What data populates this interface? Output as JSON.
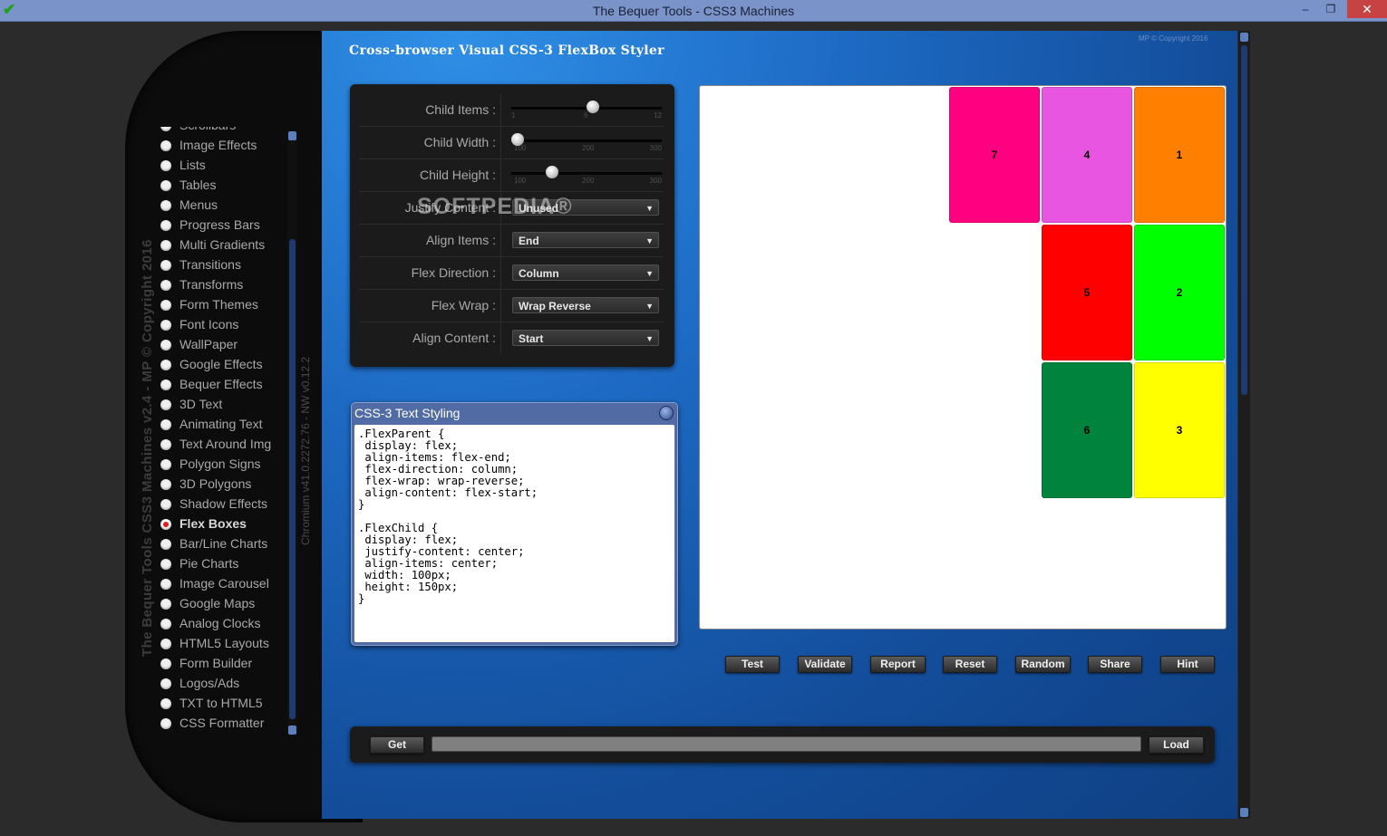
{
  "window": {
    "title": "The Bequer Tools - CSS3 Machines",
    "minimize_glyph": "–",
    "maximize_glyph": "❐",
    "close_glyph": "✕"
  },
  "sidebar": {
    "vertical_title": "The Bequer Tools CSS3 Machines v2.4 - MP © Copyright 2016",
    "vertical_version": "Chromium v41.0.2272.76 - NW v0.12.2",
    "items": [
      {
        "label": "Scrollbars",
        "selected": false
      },
      {
        "label": "Image Effects",
        "selected": false
      },
      {
        "label": "Lists",
        "selected": false
      },
      {
        "label": "Tables",
        "selected": false
      },
      {
        "label": "Menus",
        "selected": false
      },
      {
        "label": "Progress Bars",
        "selected": false
      },
      {
        "label": "Multi Gradients",
        "selected": false
      },
      {
        "label": "Transitions",
        "selected": false
      },
      {
        "label": "Transforms",
        "selected": false
      },
      {
        "label": "Form Themes",
        "selected": false
      },
      {
        "label": "Font Icons",
        "selected": false
      },
      {
        "label": "WallPaper",
        "selected": false
      },
      {
        "label": "Google Effects",
        "selected": false
      },
      {
        "label": "Bequer Effects",
        "selected": false
      },
      {
        "label": "3D Text",
        "selected": false
      },
      {
        "label": "Animating Text",
        "selected": false
      },
      {
        "label": "Text Around Img",
        "selected": false
      },
      {
        "label": "Polygon Signs",
        "selected": false
      },
      {
        "label": "3D Polygons",
        "selected": false
      },
      {
        "label": "Shadow Effects",
        "selected": false
      },
      {
        "label": "Flex Boxes",
        "selected": true
      },
      {
        "label": "Bar/Line Charts",
        "selected": false
      },
      {
        "label": "Pie Charts",
        "selected": false
      },
      {
        "label": "Image Carousel",
        "selected": false
      },
      {
        "label": "Google Maps",
        "selected": false
      },
      {
        "label": "Analog Clocks",
        "selected": false
      },
      {
        "label": "HTML5 Layouts",
        "selected": false
      },
      {
        "label": "Form Builder",
        "selected": false
      },
      {
        "label": "Logos/Ads",
        "selected": false
      },
      {
        "label": "TXT to HTML5",
        "selected": false
      },
      {
        "label": "CSS Formatter",
        "selected": false
      }
    ]
  },
  "main": {
    "title": "Cross-browser Visual CSS-3 FlexBox Styler",
    "copyright": "MP © Copyright 2016",
    "watermark": "SOFTPEDIA®"
  },
  "controls": {
    "child_items": {
      "label": "Child Items :",
      "value": 7,
      "min": 1,
      "max": 12,
      "ticks": [
        "1",
        "6",
        "12"
      ]
    },
    "child_width": {
      "label": "Child Width :",
      "value": 100,
      "min": 100,
      "max": 300,
      "ticks": [
        "100",
        "200",
        "300"
      ]
    },
    "child_height": {
      "label": "Child Height :",
      "value": 150,
      "min": 100,
      "max": 300,
      "ticks": [
        "100",
        "200",
        "300"
      ]
    },
    "justify_content": {
      "label": "Justify Content :",
      "value": "Unused"
    },
    "align_items": {
      "label": "Align Items :",
      "value": "End"
    },
    "flex_direction": {
      "label": "Flex Direction :",
      "value": "Column"
    },
    "flex_wrap": {
      "label": "Flex Wrap :",
      "value": "Wrap Reverse"
    },
    "align_content": {
      "label": "Align Content :",
      "value": "Start"
    }
  },
  "css_panel": {
    "title": "CSS-3 Text Styling",
    "code": ".FlexParent {\n display: flex;\n align-items: flex-end;\n flex-direction: column;\n flex-wrap: wrap-reverse;\n align-content: flex-start;\n}\n\n.FlexChild {\n display: flex;\n justify-content: center;\n align-items: center;\n width: 100px;\n height: 150px;\n}"
  },
  "preview": {
    "items": [
      {
        "label": "1",
        "color": "#ff8000"
      },
      {
        "label": "2",
        "color": "#00ff00"
      },
      {
        "label": "3",
        "color": "#ffff00"
      },
      {
        "label": "4",
        "color": "#e855e0"
      },
      {
        "label": "5",
        "color": "#ff0000"
      },
      {
        "label": "6",
        "color": "#00843d"
      },
      {
        "label": "7",
        "color": "#ff0080"
      }
    ]
  },
  "actions": {
    "test": "Test",
    "validate": "Validate",
    "report": "Report",
    "reset": "Reset",
    "random": "Random",
    "share": "Share",
    "hint": "Hint"
  },
  "bottom": {
    "get": "Get",
    "url_value": "",
    "load": "Load"
  }
}
